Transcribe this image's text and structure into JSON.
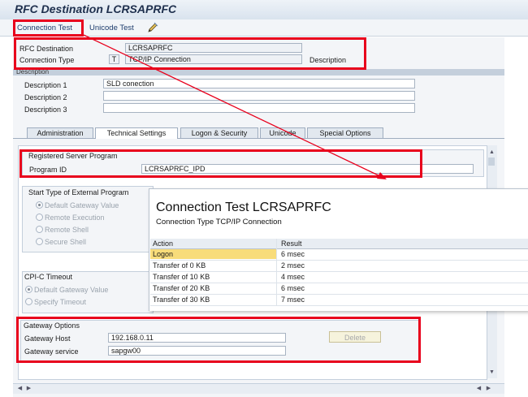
{
  "window": {
    "title": "RFC Destination LCRSAPRFC"
  },
  "toolbar": {
    "connection_test": "Connection Test",
    "unicode_test": "Unicode Test",
    "edit_icon": "pencil-icon"
  },
  "header": {
    "rfc_destination_label": "RFC Destination",
    "rfc_destination_value": "LCRSAPRFC",
    "connection_type_label": "Connection Type",
    "connection_type_code": "T",
    "connection_type_value": "TCP/IP Connection",
    "description_label": "Description"
  },
  "description": {
    "section_title": "Description",
    "rows": [
      {
        "label": "Description 1",
        "value": "SLD conection"
      },
      {
        "label": "Description 2",
        "value": ""
      },
      {
        "label": "Description 3",
        "value": ""
      }
    ]
  },
  "tabs": [
    {
      "label": "Administration"
    },
    {
      "label": "Technical Settings"
    },
    {
      "label": "Logon & Security"
    },
    {
      "label": "Unicode"
    },
    {
      "label": "Special Options"
    }
  ],
  "registered_server": {
    "title": "Registered Server Program",
    "program_id_label": "Program ID",
    "program_id_value": "LCRSAPRFC_IPD"
  },
  "start_type": {
    "title": "Start Type of External Program",
    "options": [
      "Default Gateway Value",
      "Remote Execution",
      "Remote Shell",
      "Secure Shell"
    ]
  },
  "cpic": {
    "title": "CPI-C Timeout",
    "options": [
      "Default Gateway Value",
      "Specify Timeout"
    ]
  },
  "gateway": {
    "title": "Gateway Options",
    "host_label": "Gateway Host",
    "host_value": "192.168.0.11",
    "service_label": "Gateway service",
    "service_value": "sapgw00",
    "delete_label": "Delete"
  },
  "popup": {
    "title": "Connection Test LCRSAPRFC",
    "subtitle": "Connection Type TCP/IP Connection",
    "columns": [
      "Action",
      "Result"
    ],
    "rows": [
      {
        "action": "Logon",
        "result": "6 msec"
      },
      {
        "action": "Transfer of 0 KB",
        "result": "2 msec"
      },
      {
        "action": "Transfer of 10 KB",
        "result": "4 msec"
      },
      {
        "action": "Transfer of 20 KB",
        "result": "6 msec"
      },
      {
        "action": "Transfer of 30 KB",
        "result": "7 msec"
      }
    ]
  },
  "colors": {
    "highlight": "#e8001c",
    "title": "#1e2f4d",
    "logon_row": "#f8dc7a"
  }
}
